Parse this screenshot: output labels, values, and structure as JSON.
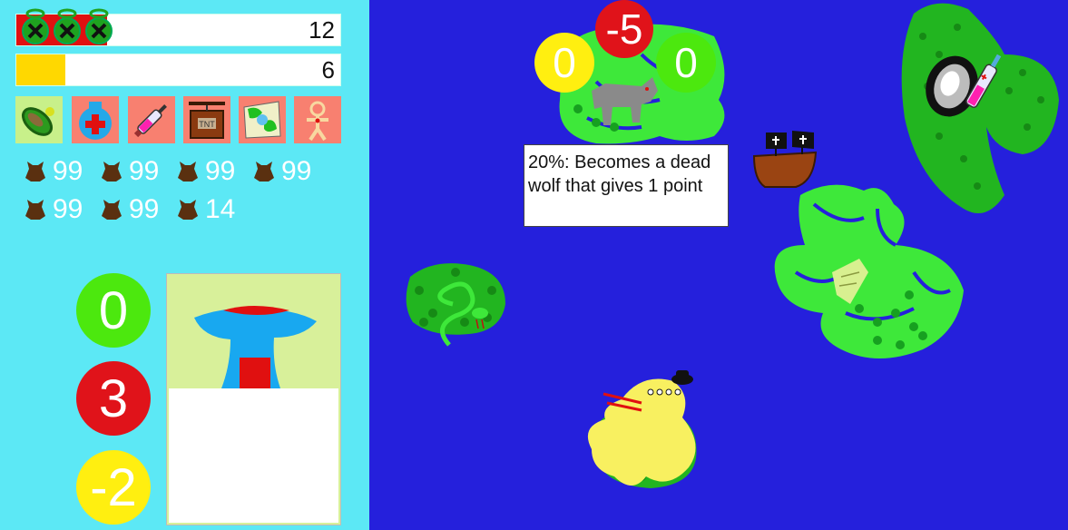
{
  "hud": {
    "health_value": "12",
    "health_fill": 0.28,
    "energy_value": "6",
    "energy_fill": 0.15,
    "colors": {
      "health": "#e01010",
      "energy": "#ffd800",
      "bar_bg": "#ffffff"
    }
  },
  "items": [
    {
      "name": "pickle-icon",
      "selected": true
    },
    {
      "name": "medicine-bottle-icon",
      "selected": false
    },
    {
      "name": "syringe-icon",
      "selected": false
    },
    {
      "name": "tnt-crate-icon",
      "selected": false
    },
    {
      "name": "world-map-icon",
      "selected": false
    },
    {
      "name": "voodoo-doll-icon",
      "selected": false
    }
  ],
  "resources": {
    "icon": "hide-pelt-icon",
    "counts": [
      "99",
      "99",
      "99",
      "99",
      "99",
      "99",
      "14"
    ]
  },
  "side_scores": {
    "green": "0",
    "red": "3",
    "yellow": "-2"
  },
  "map_scores": {
    "yellow": "0",
    "red": "-5",
    "green": "0"
  },
  "tooltip": {
    "text": "20%: Becomes a dead wolf that gives 1 point"
  },
  "colors": {
    "sidebar": "#5ce8f5",
    "water": "#2520dc",
    "island": "#22b520",
    "island_light": "#3ee83a",
    "score_green": "#4ce80e",
    "score_red": "#e0131a",
    "score_yellow": "#ffef10"
  }
}
